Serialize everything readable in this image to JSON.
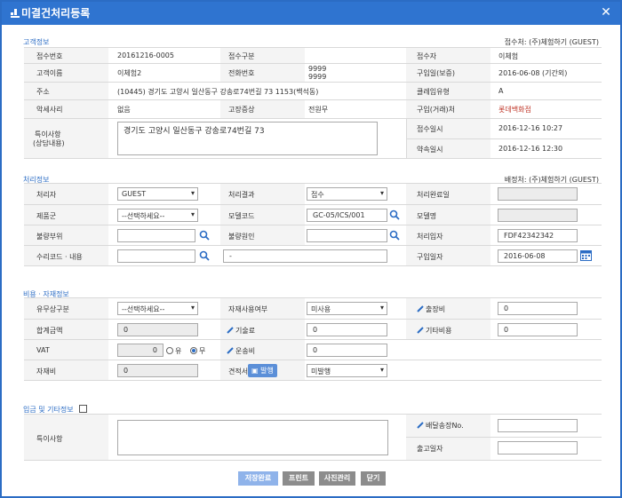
{
  "window": {
    "title": "미결건처리등록",
    "close": "✕"
  },
  "customer": {
    "section": "고객정보",
    "receiver": "접수처: (주)체험하기 (GUEST)",
    "fields": {
      "receipt_no_label": "접수번호",
      "receipt_no": "20161216-0005",
      "receipt_type_label": "접수구분",
      "receipt_type": "",
      "receiver_person_label": "접수자",
      "receiver_person": "이체험",
      "name_label": "고객이름",
      "name": "이체험2",
      "phone_label": "전화번호",
      "phone1": "9999",
      "phone2": "9999",
      "purchase_date_label": "구입일(보증)",
      "purchase_date": "2016-06-08 (기간외)",
      "address_label": "주소",
      "address": "(10445) 경기도 고양시 일산동구 강송로74번길 73 1153(백석동)",
      "claim_type_label": "클레임유형",
      "claim_type": "A",
      "malicious_label": "악세사리",
      "malicious": "없음",
      "symptom_label": "고장증상",
      "symptom": "전원무",
      "store_label": "구입(거래)처",
      "store": "롯데백화점",
      "notes_label_1": "특이사항",
      "notes_label_2": "(상담내용)",
      "notes": "경기도 고양시 일산동구 강송로74번길 73",
      "receipt_date_label": "접수일시",
      "receipt_date": "2016-12-16 10:27",
      "appointment_label": "약속일시",
      "appointment": "2016-12-16 12:30"
    }
  },
  "process": {
    "section": "처리정보",
    "dispatcher": "배정처: (주)체험하기 (GUEST)",
    "handler_label": "처리자",
    "handler": "GUEST",
    "result_label": "처리결과",
    "result": "접수",
    "done_date_label": "처리완료일",
    "done_date": "",
    "product_group_label": "제품군",
    "product_group": "--선택하세요--",
    "model_code_label": "모델코드",
    "model_code": "GC-05/ICS/001",
    "model_name_label": "모델명",
    "model_name": "",
    "defect_part_label": "불량부위",
    "defect_part": "",
    "defect_cause_label": "불량원인",
    "defect_cause": "",
    "processor_label": "처리입자",
    "processor": "FDF42342342",
    "repair_code_label": "수리코드 · 내용",
    "repair_code": "",
    "repair_desc": "-",
    "purchase_date_label": "구입일자",
    "purchase_date": "2016-06-08"
  },
  "cost": {
    "section": "비용 · 자재정보",
    "paid_label": "유무상구분",
    "paid": "--선택하세요--",
    "material_use_label": "자재사용여부",
    "material_use": "미사용",
    "travel_label": "출장비",
    "travel": "0",
    "total_label": "합계금액",
    "total": "0",
    "tech_label": "기술료",
    "tech": "0",
    "etc_label": "기타비용",
    "etc": "0",
    "vat_label": "VAT",
    "vat": "0",
    "vat_yes": "유",
    "vat_no": "무",
    "shipping_label": "운송비",
    "shipping": "0",
    "material_label": "자재비",
    "material": "0",
    "estimate_label": "견적서",
    "estimate_btn": "발행",
    "estimate_status": "미발행"
  },
  "payment": {
    "section": "입금 및 기타정보",
    "notes_label": "특이사항",
    "notes": "",
    "shipping_no_label": "배달송장No.",
    "shipping_no": "",
    "ship_date_label": "출고일자",
    "ship_date": ""
  },
  "buttons": {
    "save": "저장완료",
    "print": "프린트",
    "photo": "사진관리",
    "close": "닫기"
  },
  "colors": {
    "titlebar": "#2f74d0",
    "section": "#2b6cc4",
    "save_btn": "#8fb3ea",
    "gray_btn": "#8c8c8c"
  }
}
